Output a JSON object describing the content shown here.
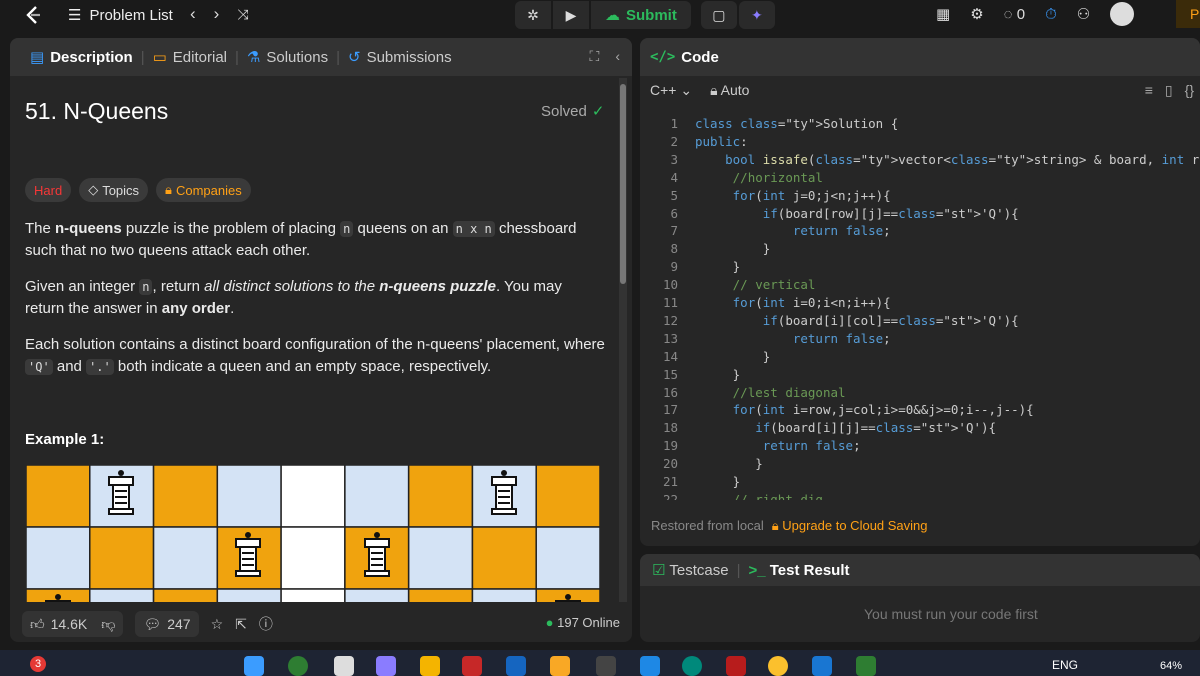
{
  "topbar": {
    "problem_list": "Problem List",
    "submit": "Submit",
    "counter": "0",
    "premium": "P"
  },
  "tabs": {
    "description": "Description",
    "editorial": "Editorial",
    "solutions": "Solutions",
    "submissions": "Submissions"
  },
  "problem": {
    "title": "51. N-Queens",
    "status": "Solved",
    "tags": {
      "difficulty": "Hard",
      "topics": "Topics",
      "companies": "Companies"
    },
    "p1": {
      "a": "The ",
      "b": "n-queens",
      "c": " puzzle is the problem of placing ",
      "d": "n",
      "e": " queens on an ",
      "f": "n x n",
      "g": " chessboard such that no two queens attack each other."
    },
    "p2": {
      "a": "Given an integer ",
      "b": "n",
      "c": ", return ",
      "d": "all distinct solutions to the ",
      "e": "n-queens puzzle",
      "f": ". You may return the answer in ",
      "g": "any order",
      "h": "."
    },
    "p3": {
      "a": "Each solution contains a distinct board configuration of the n-queens' placement, where ",
      "b": "'Q'",
      "c": " and ",
      "d": "'.'",
      "e": " both indicate a queen and an empty space, respectively."
    },
    "example_title": "Example 1:"
  },
  "bottom": {
    "likes": "14.6K",
    "comments": "247",
    "online": "197 Online"
  },
  "code": {
    "header": "Code",
    "language": "C++",
    "mode": "Auto",
    "restored": "Restored from local",
    "upgrade": "Upgrade to Cloud Saving"
  },
  "result": {
    "testcase": "Testcase",
    "test_result": "Test Result",
    "message": "You must run your code first"
  },
  "taskbar": {
    "badge": "3",
    "lang": "ENG",
    "battery": "64%"
  },
  "code_lines": [
    "class Solution {",
    "public:",
    "    bool issafe(vector<string> & board, int row,int col, int n){",
    "     //horizontal",
    "     for(int j=0;j<n;j++){",
    "         if(board[row][j]=='Q'){",
    "             return false;",
    "         }",
    "     }",
    "     // vertical",
    "     for(int i=0;i<n;i++){",
    "         if(board[i][col]=='Q'){",
    "             return false;",
    "         }",
    "     }",
    "     //lest diagonal",
    "     for(int i=row,j=col;i>=0&&j>=0;i--,j--){",
    "        if(board[i][j]=='Q'){",
    "         return false;",
    "        }",
    "     }",
    "     // right dig"
  ]
}
